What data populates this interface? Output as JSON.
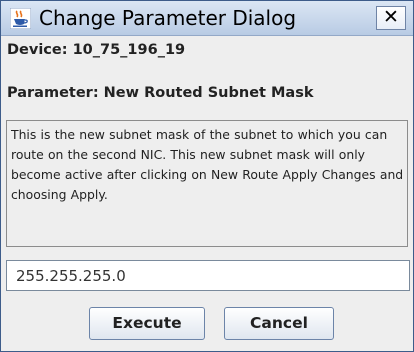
{
  "window": {
    "title": "Change Parameter Dialog",
    "app_icon": "java-coffee-cup-icon",
    "close_icon": "close-icon",
    "close_glyph": "✕"
  },
  "device_label": "Device: 10_75_196_19",
  "parameter_label": "Parameter: New Routed Subnet Mask",
  "description": "This is the new subnet mask of the subnet to which you can route on the second NIC.   This new subnet mask will only become active after clicking on New Route Apply Changes and choosing Apply.",
  "value_input": {
    "value": "255.255.255.0"
  },
  "buttons": {
    "execute": "Execute",
    "cancel": "Cancel"
  },
  "colors": {
    "titlebar_top": "#dbe6f4",
    "titlebar_bottom": "#b8cbe4",
    "dialog_background": "#eeeeee",
    "icon_orange": "#e8731c",
    "icon_blue": "#2d5aa8"
  }
}
